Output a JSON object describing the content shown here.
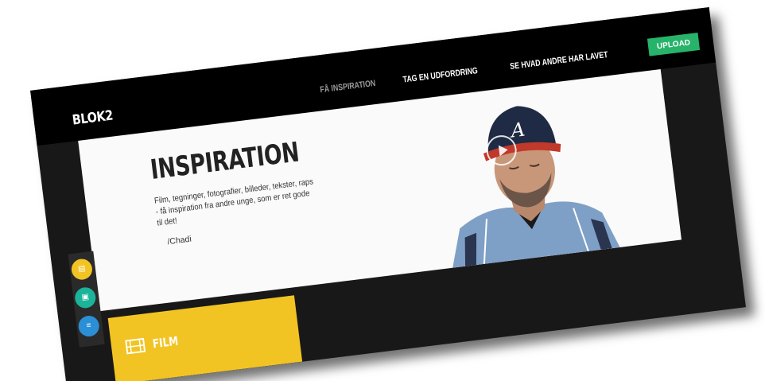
{
  "header": {
    "logo": "BLOK2",
    "nav": [
      {
        "label": "FÅ INSPIRATION",
        "active": true
      },
      {
        "label": "TAG EN UDFORDRING",
        "active": false
      },
      {
        "label": "SE HVAD ANDRE HAR LAVET",
        "active": false
      }
    ],
    "upload_label": "UPLOAD"
  },
  "hero": {
    "title": "INSPIRATION",
    "description": "Film, tegninger, fotografier, billeder, tekster, raps - få inspiration fra andre unge, som er ret gode til det!",
    "signature": "/Chadi"
  },
  "side_menu": {
    "items": [
      {
        "icon": "film-icon",
        "color": "#f2c423"
      },
      {
        "icon": "image-icon",
        "color": "#1bb39a"
      },
      {
        "icon": "text-icon",
        "color": "#2b8fd6"
      }
    ]
  },
  "category": {
    "label": "FILM",
    "icon": "film-strip-icon",
    "color": "#f2c423"
  },
  "colors": {
    "upload": "#27b36a",
    "background": "#181818",
    "topbar": "#000000"
  }
}
